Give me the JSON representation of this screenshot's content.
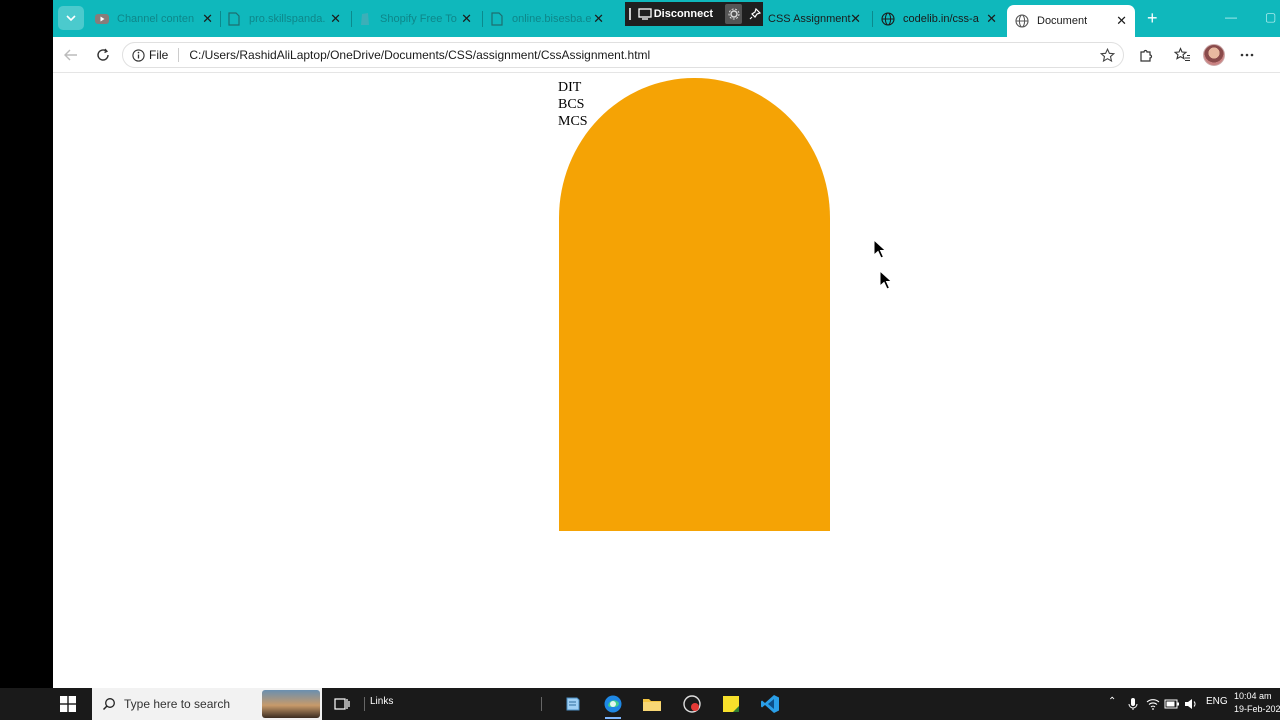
{
  "tabs": [
    {
      "title": "Channel conten",
      "icon": "youtube-studio-icon",
      "active": false
    },
    {
      "title": "pro.skillspanda.",
      "icon": "page-icon",
      "active": false
    },
    {
      "title": "Shopify Free To",
      "icon": "shopify-icon",
      "active": false
    },
    {
      "title": "online.bisesba.e",
      "icon": "page-icon",
      "active": false
    },
    {
      "title": "CSS Assignment",
      "icon": "page-icon",
      "active": false
    },
    {
      "title": "codelib.in/css-a",
      "icon": "globe-icon",
      "active": false
    },
    {
      "title": "Document",
      "icon": "globe-icon",
      "active": true
    }
  ],
  "remote_session": {
    "disconnect_label": "Disconnect"
  },
  "address_bar": {
    "scheme_label": "File",
    "url": "C:/Users/RashidAliLaptop/OneDrive/Documents/CSS/assignment/CssAssignment.html"
  },
  "page": {
    "courses": [
      "DIT",
      "BCS",
      "MCS"
    ],
    "arch_color": "#f5a305"
  },
  "taskbar": {
    "search_placeholder": "Type here to search",
    "links_label": "Links",
    "language": "ENG",
    "time": "10:04 am",
    "date": "19-Feb-202"
  },
  "colors": {
    "tabstrip": "#0fb8bc",
    "taskbar": "#1a1a1a"
  }
}
